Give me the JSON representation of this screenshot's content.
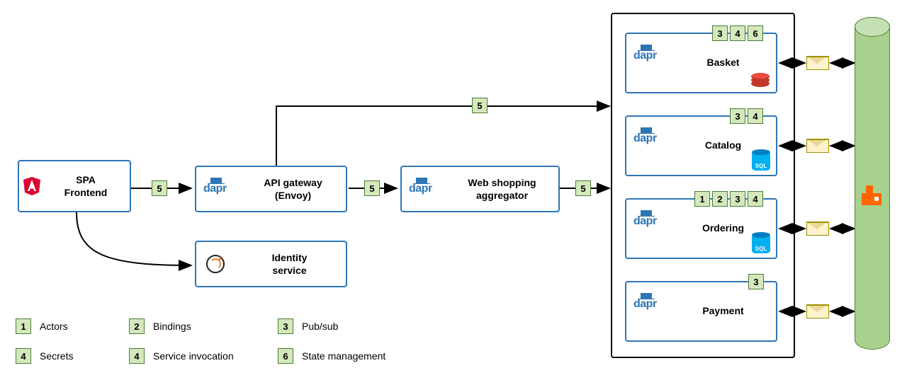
{
  "nodes": {
    "spa": {
      "label": "SPA\nFrontend"
    },
    "gateway": {
      "label": "API gateway\n(Envoy)"
    },
    "aggregator": {
      "label": "Web shopping\naggregator"
    },
    "identity": {
      "label": "Identity\nservice"
    },
    "basket": {
      "label": "Basket"
    },
    "catalog": {
      "label": "Catalog"
    },
    "ordering": {
      "label": "Ordering"
    },
    "payment": {
      "label": "Payment"
    }
  },
  "edge_badges": {
    "spa_gw": "5",
    "gw_agg": "5",
    "agg_services": "5",
    "gw_up": "5"
  },
  "service_badges": {
    "basket": [
      "3",
      "4",
      "6"
    ],
    "catalog": [
      "3",
      "4"
    ],
    "ordering": [
      "1",
      "2",
      "3",
      "4"
    ],
    "payment": [
      "3"
    ]
  },
  "legend": [
    {
      "n": "1",
      "label": "Actors"
    },
    {
      "n": "2",
      "label": "Bindings"
    },
    {
      "n": "3",
      "label": "Pub/sub"
    },
    {
      "n": "4",
      "label": "Secrets"
    },
    {
      "n": "4",
      "label": "Service invocation"
    },
    {
      "n": "6",
      "label": "State management"
    }
  ],
  "logos": {
    "dapr": "dapr",
    "sql": "SQL"
  }
}
